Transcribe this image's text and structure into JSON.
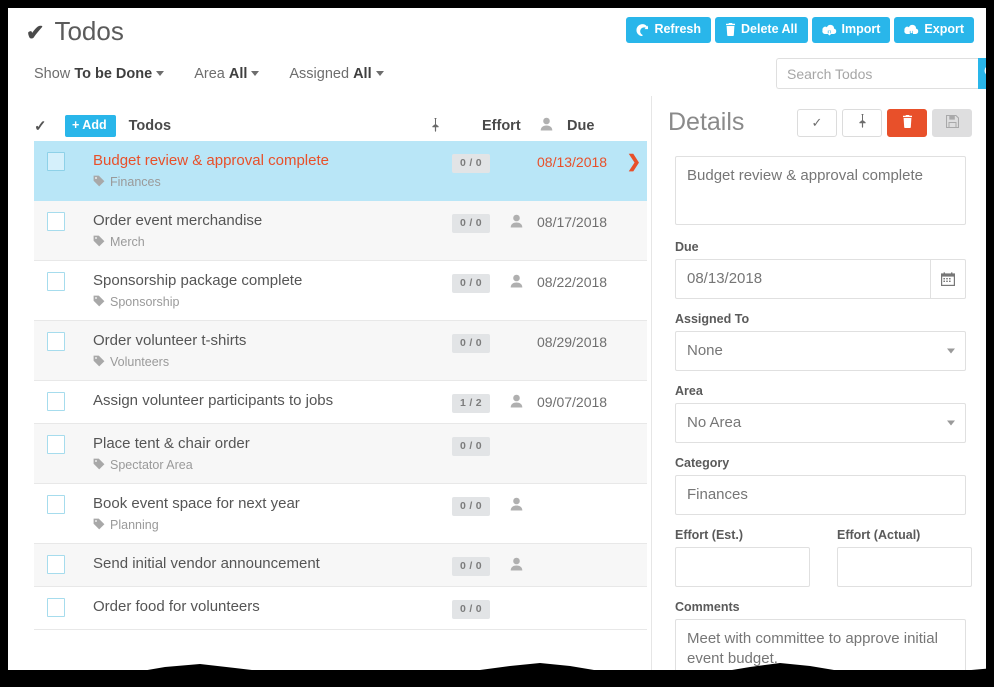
{
  "header": {
    "title": "Todos",
    "check_icon": "check-icon"
  },
  "toolbar": {
    "buttons": [
      {
        "label": "Refresh",
        "icon": "refresh-icon"
      },
      {
        "label": "Delete All",
        "icon": "trash-icon"
      },
      {
        "label": "Import",
        "icon": "cloud-download-icon"
      },
      {
        "label": "Export",
        "icon": "cloud-upload-icon"
      }
    ],
    "accent_color": "#29b6ea"
  },
  "search": {
    "placeholder": "Search Todos",
    "value": "",
    "icon": "search-icon"
  },
  "filters": [
    {
      "name": "show",
      "label": "Show",
      "value": "To be Done"
    },
    {
      "name": "area",
      "label": "Area",
      "value": "All"
    },
    {
      "name": "assigned",
      "label": "Assigned",
      "value": "All"
    }
  ],
  "list": {
    "columns": {
      "check": "check-icon",
      "add_label": "+ Add",
      "todos": "Todos",
      "pin": "pin-icon",
      "effort": "Effort",
      "person": "person-icon",
      "due": "Due"
    },
    "rows": [
      {
        "title": "Budget review & approval complete",
        "tag": "Finances",
        "effort": "0 / 0",
        "assigned": false,
        "due": "08/13/2018",
        "selected": true,
        "chevron": true
      },
      {
        "title": "Order event merchandise",
        "tag": "Merch",
        "effort": "0 / 0",
        "assigned": true,
        "due": "08/17/2018",
        "selected": false,
        "chevron": false
      },
      {
        "title": "Sponsorship package complete",
        "tag": "Sponsorship",
        "effort": "0 / 0",
        "assigned": true,
        "due": "08/22/2018",
        "selected": false,
        "chevron": false
      },
      {
        "title": "Order volunteer t-shirts",
        "tag": "Volunteers",
        "effort": "0 / 0",
        "assigned": false,
        "due": "08/29/2018",
        "selected": false,
        "chevron": false
      },
      {
        "title": "Assign volunteer participants to jobs",
        "tag": "",
        "effort": "1 / 2",
        "assigned": true,
        "due": "09/07/2018",
        "selected": false,
        "chevron": false
      },
      {
        "title": "Place tent & chair order",
        "tag": "Spectator Area",
        "effort": "0 / 0",
        "assigned": false,
        "due": "",
        "selected": false,
        "chevron": false
      },
      {
        "title": "Book event space for next year",
        "tag": "Planning",
        "effort": "0 / 0",
        "assigned": true,
        "due": "",
        "selected": false,
        "chevron": false
      },
      {
        "title": "Send initial vendor announcement",
        "tag": "",
        "effort": "0 / 0",
        "assigned": true,
        "due": "",
        "selected": false,
        "chevron": false
      },
      {
        "title": "Order food for volunteers",
        "tag": "",
        "effort": "0 / 0",
        "assigned": false,
        "due": "",
        "selected": false,
        "chevron": false
      }
    ]
  },
  "details": {
    "title": "Details",
    "actions": [
      {
        "name": "complete",
        "icon": "check-icon",
        "style": "default"
      },
      {
        "name": "pin",
        "icon": "pin-icon",
        "style": "default"
      },
      {
        "name": "delete",
        "icon": "trash-icon",
        "style": "danger",
        "color": "#e8502a"
      },
      {
        "name": "save",
        "icon": "save-icon",
        "style": "disabled"
      }
    ],
    "todo_title": "Budget review & approval complete",
    "due": {
      "label": "Due",
      "value": "08/13/2018",
      "icon": "calendar-icon"
    },
    "assigned_to": {
      "label": "Assigned To",
      "value": "None"
    },
    "area": {
      "label": "Area",
      "value": "No Area"
    },
    "category": {
      "label": "Category",
      "value": "Finances"
    },
    "effort_est": {
      "label": "Effort (Est.)",
      "value": ""
    },
    "effort_actual": {
      "label": "Effort (Actual)",
      "value": ""
    },
    "comments": {
      "label": "Comments",
      "value": "Meet with committee to approve initial event budget."
    }
  }
}
